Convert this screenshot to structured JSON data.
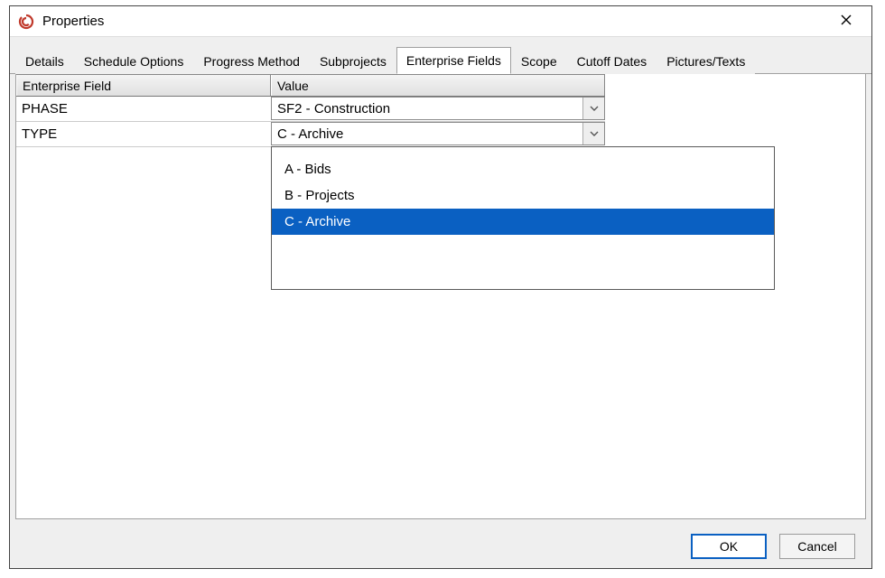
{
  "window": {
    "title": "Properties"
  },
  "tabs": [
    {
      "label": "Details"
    },
    {
      "label": "Schedule Options"
    },
    {
      "label": "Progress Method"
    },
    {
      "label": "Subprojects"
    },
    {
      "label": "Enterprise Fields",
      "active": true
    },
    {
      "label": "Scope"
    },
    {
      "label": "Cutoff Dates"
    },
    {
      "label": "Pictures/Texts"
    }
  ],
  "grid": {
    "headers": {
      "field": "Enterprise Field",
      "value": "Value"
    },
    "rows": [
      {
        "field": "PHASE",
        "value": "SF2 - Construction"
      },
      {
        "field": "TYPE",
        "value": "C - Archive"
      }
    ]
  },
  "dropdown": {
    "options": [
      {
        "label": "A - Bids"
      },
      {
        "label": "B - Projects"
      },
      {
        "label": "C - Archive",
        "selected": true
      }
    ]
  },
  "buttons": {
    "ok": "OK",
    "cancel": "Cancel"
  }
}
